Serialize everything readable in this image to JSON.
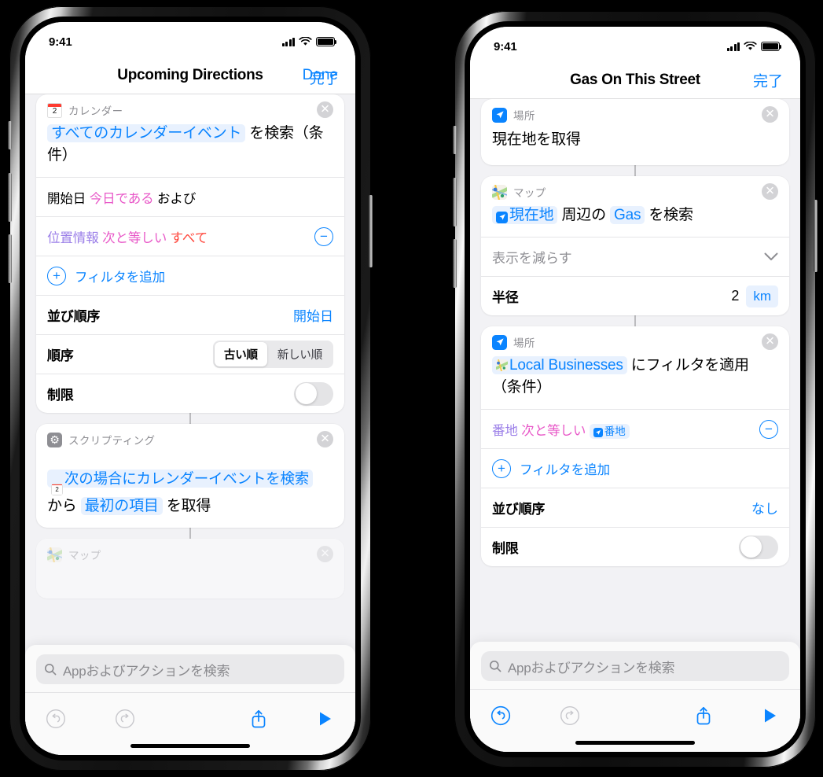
{
  "left_phone": {
    "status": {
      "time": "9:41",
      "signal_icon": "cellular-bars-icon",
      "wifi_icon": "wifi-icon",
      "battery_icon": "battery-full-icon"
    },
    "nav": {
      "title": "Upcoming Directions",
      "done_en": "Done",
      "done_ja": "完了"
    },
    "cards": [
      {
        "app": "カレンダー",
        "icon": "calendar-icon",
        "icon_day": "2",
        "sentence": {
          "pre": "",
          "token": "すべてのカレンダーイベント",
          "post": "を検索（条件）"
        },
        "rows": [
          {
            "kind": "filter-plain",
            "field": "開始日",
            "op": "今日である",
            "tail": "および"
          },
          {
            "kind": "filter",
            "field": "位置情報",
            "op": "次と等しい",
            "value": "すべて",
            "action": "minus"
          },
          {
            "kind": "add",
            "label": "フィルタを追加"
          },
          {
            "kind": "value",
            "label": "並び順序",
            "value": "開始日"
          },
          {
            "kind": "segment",
            "label": "順序",
            "options": [
              "古い順",
              "新しい順"
            ],
            "selected": "古い順"
          },
          {
            "kind": "toggle",
            "label": "制限",
            "on": false
          }
        ]
      },
      {
        "app": "スクリプティング",
        "icon": "gear-icon",
        "sentence2": {
          "token_icon": "calendar-icon",
          "token": "次の場合にカレンダーイベントを検索",
          "mid": "から",
          "token2": "最初の項目",
          "post": "を取得"
        }
      },
      {
        "app": "マップ",
        "icon": "maps-icon",
        "partial": true
      }
    ],
    "search": {
      "placeholder": "Appおよびアクションを検索",
      "icon": "search-icon"
    },
    "toolbar": {
      "undo": "undo-icon",
      "redo": "redo-icon",
      "share": "share-icon",
      "play": "play-icon",
      "undo_enabled": false
    }
  },
  "right_phone": {
    "status": {
      "time": "9:41",
      "signal_icon": "cellular-bars-icon",
      "wifi_icon": "wifi-icon",
      "battery_icon": "battery-full-icon"
    },
    "nav": {
      "title": "Gas On This Street",
      "done_ja": "完了"
    },
    "cards": [
      {
        "app": "場所",
        "icon": "location-icon",
        "sentence": "現在地を取得"
      },
      {
        "app": "マップ",
        "icon": "maps-icon",
        "sentence": {
          "token_icon": "location-icon",
          "token": "現在地",
          "mid": "周辺の",
          "token2": "Gas",
          "post": "を検索"
        },
        "rows": [
          {
            "kind": "collapse",
            "label": "表示を減らす",
            "icon": "chevron-down-icon"
          },
          {
            "kind": "radius",
            "label": "半径",
            "value": "2",
            "unit": "km"
          }
        ]
      },
      {
        "app": "場所",
        "icon": "location-icon",
        "sentence": {
          "token_icon": "maps-icon",
          "token": "Local Businesses",
          "post": "にフィルタを適用（条件）"
        },
        "rows": [
          {
            "kind": "filter-token",
            "field": "番地",
            "op": "次と等しい",
            "value": "番地",
            "value_icon": "location-icon",
            "action": "minus"
          },
          {
            "kind": "add",
            "label": "フィルタを追加"
          },
          {
            "kind": "value",
            "label": "並び順序",
            "value": "なし"
          },
          {
            "kind": "toggle",
            "label": "制限",
            "on": false
          }
        ]
      }
    ],
    "search": {
      "placeholder": "Appおよびアクションを検索",
      "icon": "search-icon"
    },
    "toolbar": {
      "undo": "undo-icon",
      "redo": "redo-icon",
      "share": "share-icon",
      "play": "play-icon",
      "undo_enabled": true
    }
  },
  "colors": {
    "accent": "#0a84ff",
    "token_bg": "#e8f1fe",
    "page_bg": "#f2f2f5",
    "card_bg": "#ffffff",
    "frame": "#000000"
  }
}
